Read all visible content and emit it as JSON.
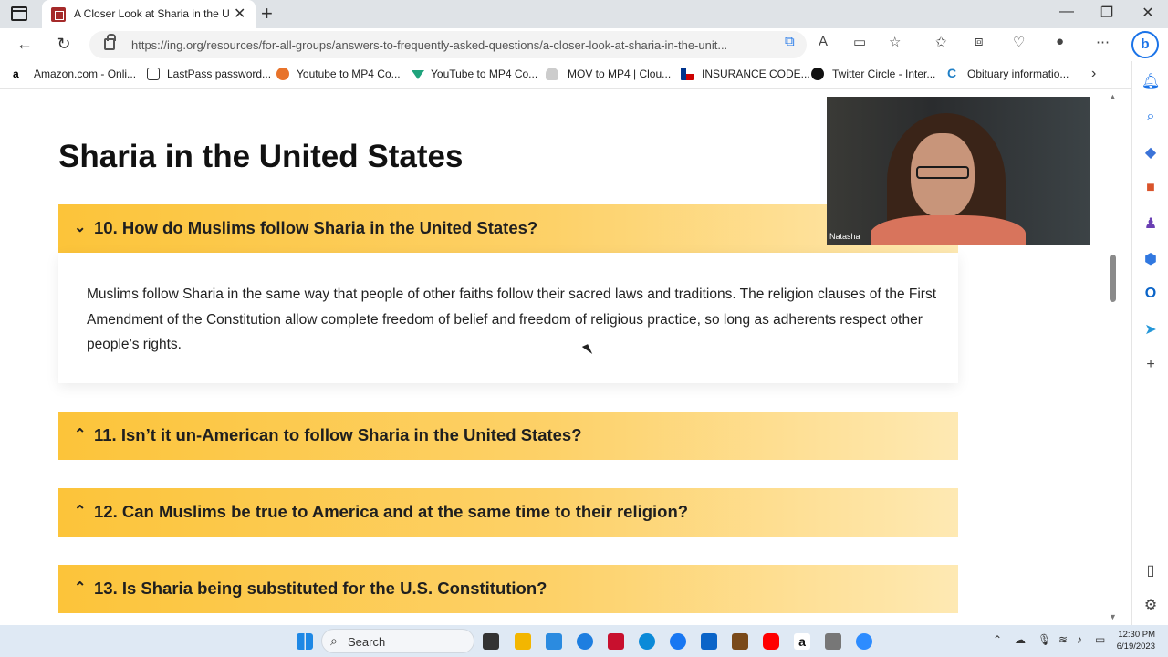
{
  "browser": {
    "tab_title": "A Closer Look at Sharia in the Un",
    "url": "https://ing.org/resources/for-all-groups/answers-to-frequently-asked-questions/a-closer-look-at-sharia-in-the-unit...",
    "bookmarks": [
      "Amazon.com - Onli...",
      "LastPass password...",
      "Youtube to MP4 Co...",
      "YouTube to MP4 Co...",
      "MOV to MP4 | Clou...",
      "INSURANCE CODE...",
      "Twitter Circle - Inter...",
      "Obituary informatio..."
    ]
  },
  "page": {
    "heading": "Sharia in the United States",
    "faq": [
      {
        "q": "10. How do Muslims follow Sharia in the United States?",
        "open": true
      },
      {
        "q": "11. Isn’t it un-American to follow Sharia in the United States?",
        "open": false
      },
      {
        "q": "12. Can Muslims be true to America and at the same time to their religion?",
        "open": false
      },
      {
        "q": "13. Is Sharia being substituted for the U.S. Constitution?",
        "open": false
      }
    ],
    "answer": "Muslims follow Sharia in the same way that people of other faiths follow their sacred laws and traditions. The religion clauses of the First Amendment of the Constitution allow complete freedom of belief and freedom of religious practice, so long as adherents respect other people’s rights."
  },
  "webcam": {
    "name": "Natasha"
  },
  "taskbar": {
    "search_label": "Search",
    "time": "12:30 PM",
    "date": "6/19/2023"
  },
  "colors": {
    "accordion_start": "#fcc43a",
    "accordion_end": "#fee9b3"
  }
}
